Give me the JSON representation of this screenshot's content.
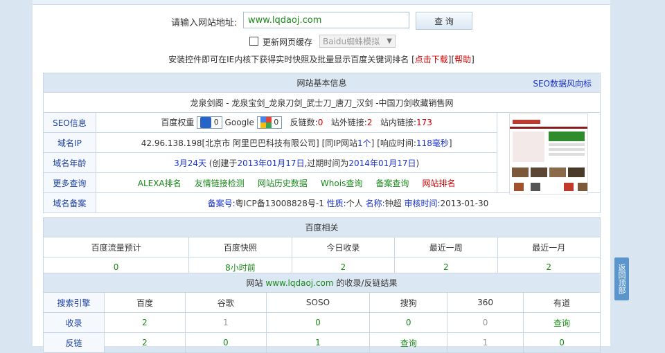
{
  "search": {
    "label": "请输入网站地址:",
    "value": "www.lqdaoj.com",
    "button": "查 询"
  },
  "cache": {
    "checkbox_label": "更新网页缓存",
    "spider_select": "Baidu蜘蛛模拟"
  },
  "install": {
    "text": "安装控件即可在IE内核下获得实时快照及批量显示百度关键词排名",
    "download": "点击下载",
    "help": "帮助"
  },
  "basic": {
    "header": "网站基本信息",
    "seo_link": "SEO数据风向标",
    "site_title": "龙泉剑阁 - 龙泉宝剑_龙泉刀剑_武士刀_唐刀_汉剑 -中国刀剑收藏销售网",
    "seo_label": "SEO信息",
    "baidu_weight_label": "百度权重",
    "baidu_weight": "0",
    "google_label": "Google",
    "google_pr": "0",
    "backlinks_label": "反链数:",
    "backlinks": "0",
    "external_label": "站外链接:",
    "external": "2",
    "internal_label": "站内链接:",
    "internal": "173",
    "ip_label": "域名IP",
    "ip_text": "42.96.138.198[北京市 阿里巴巴科技有限公司]",
    "same_ip_pre": "[同IP网站",
    "same_ip_count": "1个",
    "same_ip_post": "]",
    "response_pre": "[响应时间:",
    "response_value": "118毫秒",
    "response_post": "]",
    "age_label": "域名年龄",
    "age_value": "3月24天",
    "age_created_pre": "(创建于",
    "age_created": "2013年01月17日",
    "age_expire_pre": ",过期时间为",
    "age_expire": "2014年01月17日",
    "age_post": ")",
    "more_label": "更多查询",
    "more_links": [
      "ALEXA排名",
      "友情链接检测",
      "网站历史数据",
      "Whois查询",
      "备案查询",
      "网站排名"
    ],
    "icp_label": "域名备案",
    "icp_no_label": "备案号:",
    "icp_no": "粤ICP备13008828号-1",
    "nature_label": "性质:",
    "nature": "个人",
    "name_label": "名称:",
    "name": "钟超",
    "audit_label": "审核时间:",
    "audit": "2013-01-30"
  },
  "baidu": {
    "header": "百度相关",
    "columns": [
      "百度流量预计",
      "百度快照",
      "今日收录",
      "最近一周",
      "最近一月"
    ],
    "values": [
      "0",
      "8小时前",
      "2",
      "2",
      "2"
    ]
  },
  "index": {
    "header_pre": "网站",
    "header_site": "www.lqdaoj.com",
    "header_post": "的收录/反链结果",
    "columns": [
      "搜索引擎",
      "百度",
      "谷歌",
      "SOSO",
      "搜狗",
      "360",
      "有道"
    ],
    "row1_label": "收录",
    "row1": [
      "2",
      "1",
      "0",
      "0",
      "0",
      "查询"
    ],
    "row2_label": "反链",
    "row2": [
      "2",
      "0",
      "1",
      "查询",
      "1",
      "0"
    ]
  },
  "back_to_top": "返回顶部"
}
